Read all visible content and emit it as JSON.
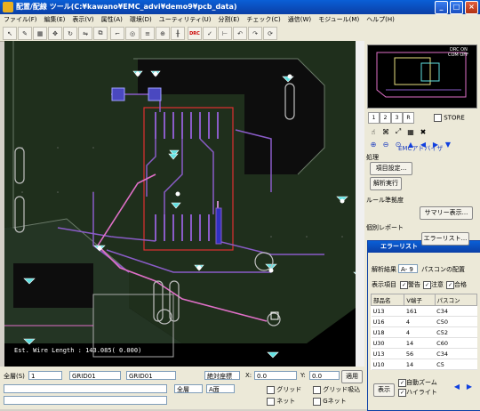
{
  "title": "配置/配線 ツール(C:¥kawano¥EMC_advi¥demo9¥pcb_data)",
  "window_buttons": [
    "_",
    "□",
    "×"
  ],
  "menu": [
    "ファイル(F)",
    "編集(E)",
    "表示(V)",
    "属性(A)",
    "環境(D)",
    "ユーティリティ(U)",
    "分割(E)",
    "チェック(C)",
    "通信(W)",
    "モジュール(M)",
    "ヘルプ(H)"
  ],
  "toolbar": {
    "drc_label": "DRC"
  },
  "canvas": {
    "status_text": "Est. Wire Length : 143.085( 0.000)"
  },
  "bottom": {
    "layer_label": "全層(S)",
    "layer_value": "1",
    "grid1_label": "GRID01",
    "grid2_label": "GRID01",
    "coord_mode": "絶対座標",
    "x_label": "X:",
    "x_value": "0.0",
    "y_label": "Y:",
    "y_value": "0.0",
    "apply_label": "適用",
    "all_layers": "全層",
    "a_label": "A面",
    "grid_chk": "グリッド",
    "grid_snap_chk": "グリッド吸込",
    "net_chk": "ネット",
    "gnet_chk": "Gネット"
  },
  "right": {
    "mini_labels": [
      "DRC ON",
      "COM OFF"
    ],
    "tabs": [
      "1",
      "2",
      "3",
      "R"
    ],
    "store_label": "STORE",
    "emc_title": "EMCアドバイザ",
    "section_process": "処理",
    "btn_item_settings": "項目設定...",
    "btn_run": "解析実行",
    "section_rule": "ルール準拠度",
    "btn_summary": "サマリー表示...",
    "section_report": "個別レポート",
    "btn_errors": "エラーリスト..."
  },
  "error_dialog": {
    "title": "エラーリスト",
    "result_label": "解析結果",
    "result_value": "A- 9",
    "result_desc": "パスコンの配置",
    "display_label": "表示項目",
    "chk_warning": "警告",
    "chk_caution": "注意",
    "chk_pass": "合格",
    "headers": [
      "部品名",
      "V端子",
      "パスコン"
    ],
    "rows": [
      [
        "U13",
        "161",
        "C34"
      ],
      [
        "U16",
        "4",
        "C50"
      ],
      [
        "U18",
        "4",
        "C52"
      ],
      [
        "U30",
        "14",
        "C60"
      ],
      [
        "U13",
        "56",
        "C34"
      ],
      [
        "U10",
        "14",
        "C5"
      ]
    ],
    "btn_show": "表示",
    "chk_autozoom": "自動ズーム",
    "chk_highlight": "ハイライト"
  },
  "colors": {
    "title_blue": "#0b3fa6",
    "board_green": "#1f2f1c",
    "trace_purple": "#8a5cc8",
    "pad_cyan": "#60e0e0",
    "trace_pink": "#e070c8"
  }
}
